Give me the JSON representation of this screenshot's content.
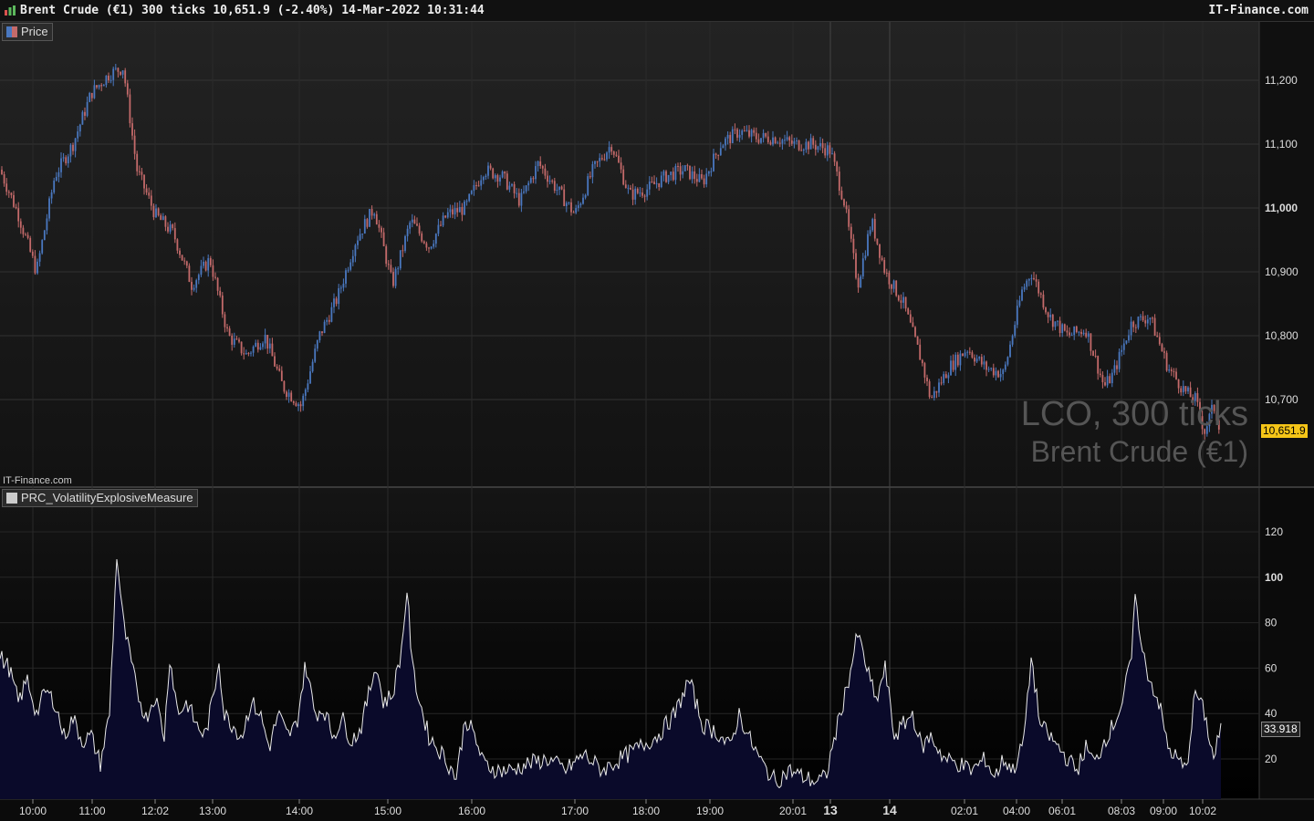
{
  "window": {
    "title": "Brent Crude (€1) 300 ticks 10,651.9 (-2.40%) 14-Mar-2022 10:31:44",
    "brand": "IT-Finance.com"
  },
  "price_panel": {
    "legend": "Price",
    "watermark_line1": "LCO, 300 ticks",
    "watermark_line2": "Brent Crude (€1)",
    "source_label": "IT-Finance.com",
    "last_value": "10,651.9",
    "last_value_color": "#f5c518",
    "up_color": "#4a78c0",
    "down_color": "#c46a6a"
  },
  "indicator_panel": {
    "legend": "PRC_VolatilityExplosiveMeasure",
    "last_value": "33.918",
    "line_color": "#e8e8e8",
    "fill_color": "#0a0a2a"
  },
  "chart_data": [
    {
      "type": "line",
      "name": "Price",
      "x_tick_labels": [
        "10:00",
        "11:00",
        "12:02",
        "13:00",
        "14:00",
        "15:00",
        "16:00",
        "17:00",
        "18:00",
        "19:00",
        "20:01",
        "13",
        "14",
        "02:01",
        "04:00",
        "06:01",
        "08:03",
        "09:00",
        "10:02"
      ],
      "y_tick_labels": [
        "11,200",
        "11,100",
        "11,000",
        "10,900",
        "10,800",
        "10,700"
      ],
      "ylim": [
        10620,
        11290
      ],
      "grid": true,
      "x": [
        0,
        20,
        40,
        60,
        80,
        100,
        120,
        135,
        150,
        170,
        190,
        210,
        230,
        250,
        270,
        290,
        310,
        330,
        350,
        370,
        390,
        410,
        430,
        450,
        470,
        490,
        510,
        530,
        550,
        570,
        590,
        610,
        630,
        650,
        670,
        690,
        710,
        730,
        750,
        770,
        790,
        810,
        830,
        850,
        870,
        890,
        910,
        925,
        940,
        955,
        970,
        990,
        1010,
        1020,
        1040,
        1060,
        1080,
        1100,
        1120,
        1130,
        1150,
        1170,
        1190,
        1210,
        1220,
        1240,
        1260,
        1280,
        1300,
        1310,
        1320,
        1330,
        1338
      ],
      "values": [
        11060,
        10990,
        10900,
        11050,
        11100,
        11180,
        11210,
        11220,
        11060,
        10990,
        10960,
        10880,
        10920,
        10800,
        10770,
        10800,
        10720,
        10690,
        10800,
        10860,
        10950,
        11000,
        10880,
        10980,
        10940,
        10990,
        11000,
        11060,
        11050,
        11010,
        11070,
        11030,
        10990,
        11060,
        11100,
        11020,
        11030,
        11050,
        11060,
        11040,
        11100,
        11120,
        11110,
        11110,
        11100,
        11100,
        11090,
        11010,
        10880,
        10980,
        10900,
        10850,
        10760,
        10700,
        10750,
        10780,
        10750,
        10740,
        10870,
        10900,
        10830,
        10800,
        10810,
        10720,
        10740,
        10820,
        10830,
        10750,
        10710,
        10700,
        10650,
        10690,
        10652
      ]
    },
    {
      "type": "area",
      "name": "PRC_VolatilityExplosiveMeasure",
      "y_tick_labels": [
        "120",
        "100",
        "80",
        "60",
        "40",
        "20"
      ],
      "ylim": [
        0,
        130
      ],
      "grid": true,
      "x": [
        0,
        10,
        20,
        30,
        40,
        50,
        60,
        70,
        80,
        90,
        100,
        110,
        120,
        128,
        135,
        140,
        150,
        160,
        170,
        180,
        186,
        195,
        205,
        215,
        225,
        235,
        240,
        245,
        255,
        265,
        275,
        285,
        295,
        305,
        315,
        325,
        335,
        345,
        355,
        365,
        375,
        385,
        395,
        405,
        412,
        420,
        430,
        440,
        446,
        452,
        460,
        470,
        485,
        500,
        510,
        520,
        530,
        545,
        560,
        580,
        600,
        620,
        640,
        660,
        680,
        700,
        720,
        740,
        755,
        770,
        785,
        800,
        810,
        820,
        835,
        850,
        865,
        880,
        895,
        905,
        915,
        930,
        940,
        950,
        960,
        970,
        980,
        990,
        1000,
        1010,
        1020,
        1035,
        1050,
        1065,
        1080,
        1090,
        1100,
        1110,
        1120,
        1125,
        1130,
        1140,
        1150,
        1160,
        1170,
        1180,
        1190,
        1200,
        1210,
        1220,
        1230,
        1240,
        1245,
        1250,
        1260,
        1270,
        1280,
        1290,
        1300,
        1310,
        1320,
        1330,
        1338
      ],
      "values": [
        65,
        60,
        45,
        55,
        40,
        50,
        45,
        30,
        38,
        28,
        30,
        18,
        40,
        110,
        80,
        70,
        50,
        38,
        48,
        30,
        65,
        40,
        45,
        35,
        30,
        50,
        65,
        40,
        35,
        30,
        45,
        40,
        25,
        40,
        30,
        35,
        62,
        40,
        42,
        30,
        38,
        28,
        33,
        50,
        62,
        45,
        48,
        68,
        95,
        60,
        45,
        30,
        22,
        12,
        38,
        30,
        18,
        15,
        15,
        18,
        20,
        15,
        22,
        15,
        20,
        25,
        30,
        40,
        55,
        35,
        32,
        25,
        40,
        30,
        18,
        10,
        15,
        12,
        10,
        12,
        30,
        55,
        75,
        60,
        45,
        60,
        30,
        35,
        40,
        25,
        30,
        20,
        18,
        15,
        20,
        12,
        20,
        15,
        25,
        40,
        65,
        35,
        30,
        25,
        20,
        15,
        25,
        18,
        28,
        35,
        45,
        65,
        95,
        70,
        55,
        45,
        25,
        20,
        15,
        50,
        40,
        20,
        34
      ]
    }
  ]
}
